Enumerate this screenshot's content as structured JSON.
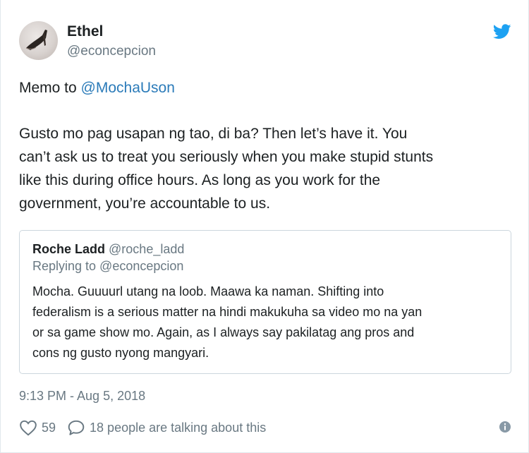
{
  "author": {
    "name": "Ethel",
    "handle": "@econcepcion",
    "avatar_icon": "avatar-shoe-photo"
  },
  "brand": {
    "icon": "twitter-bird-icon",
    "color": "#1da1f2"
  },
  "tweet": {
    "line1_prefix": "Memo to ",
    "line1_mention": "@MochaUson",
    "body_line1": "Gusto mo pag usapan ng tao, di ba? Then let’s have it. You",
    "body_line2": "can’t ask us to treat you seriously when you make stupid stunts",
    "body_line3": "like this during office hours. As long as you work for the",
    "body_line4": "government, you’re accountable to us."
  },
  "quoted": {
    "name": "Roche Ladd",
    "handle": "@roche_ladd",
    "replying": "Replying to @econcepcion",
    "body_line1": "Mocha. Guuuurl utang na loob. Maawa ka naman. Shifting into",
    "body_line2": "federalism is a serious matter na hindi makukuha sa video mo na yan",
    "body_line3": "or sa game show mo. Again, as I always say pakilatag ang pros and",
    "body_line4": "cons ng gusto nyong mangyari."
  },
  "timestamp": "9:13 PM - Aug 5, 2018",
  "actions": {
    "likes": "59",
    "talking": "18 people are talking about this",
    "like_icon": "heart-icon",
    "reply_icon": "speech-bubble-icon",
    "info_icon": "info-icon"
  },
  "colors": {
    "link": "#2b7bb9",
    "muted": "#697882",
    "text": "#1c2022",
    "border": "#ccd6dd"
  }
}
